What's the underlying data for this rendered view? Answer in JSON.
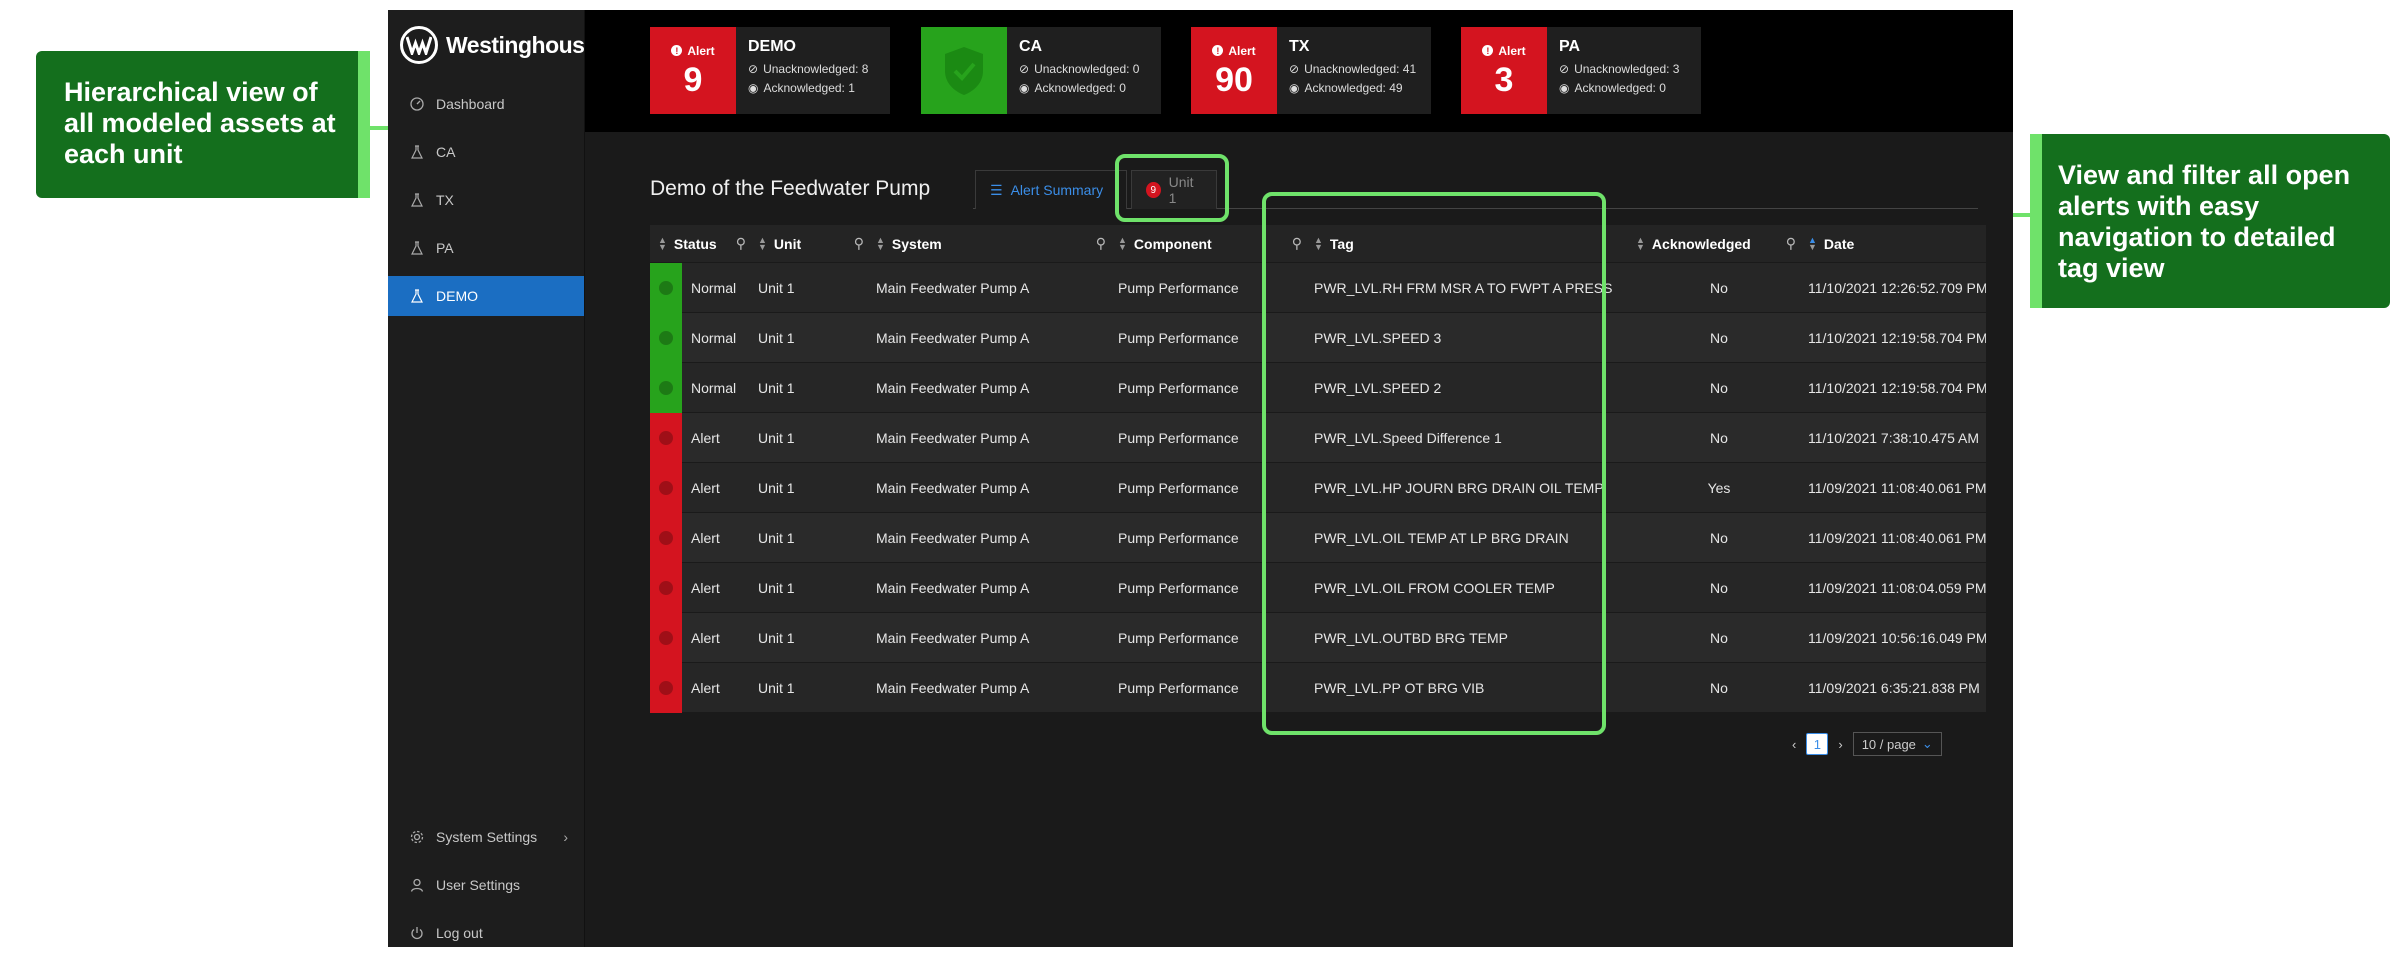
{
  "brand": {
    "name": "Westinghouse"
  },
  "sidebar": {
    "items": [
      {
        "label": "Dashboard",
        "icon": "dashboard-icon"
      },
      {
        "label": "CA",
        "icon": "flask-icon"
      },
      {
        "label": "TX",
        "icon": "flask-icon"
      },
      {
        "label": "PA",
        "icon": "flask-icon"
      },
      {
        "label": "DEMO",
        "icon": "flask-icon",
        "active": true
      }
    ],
    "bottom": [
      {
        "label": "System Settings",
        "icon": "gear-icon"
      },
      {
        "label": "User Settings",
        "icon": "user-icon"
      },
      {
        "label": "Log out",
        "icon": "power-icon"
      }
    ]
  },
  "cards": [
    {
      "name": "DEMO",
      "alert_label": "Alert",
      "count": "9",
      "unack": "Unacknowledged: 8",
      "ack": "Acknowledged: 1",
      "state": "alert"
    },
    {
      "name": "CA",
      "alert_label": "",
      "count": "",
      "unack": "Unacknowledged: 0",
      "ack": "Acknowledged: 0",
      "state": "ok"
    },
    {
      "name": "TX",
      "alert_label": "Alert",
      "count": "90",
      "unack": "Unacknowledged: 41",
      "ack": "Acknowledged: 49",
      "state": "alert"
    },
    {
      "name": "PA",
      "alert_label": "Alert",
      "count": "3",
      "unack": "Unacknowledged: 3",
      "ack": "Acknowledged: 0",
      "state": "alert"
    }
  ],
  "page": {
    "title": "Demo of the Feedwater Pump",
    "tabs": [
      {
        "label": "Alert Summary",
        "active": true
      },
      {
        "label": "Unit 1",
        "badge": "9"
      }
    ]
  },
  "table": {
    "columns": [
      "Status",
      "Unit",
      "System",
      "Component",
      "Tag",
      "Acknowledged",
      "Date"
    ],
    "rows": [
      {
        "status": "Normal",
        "unit": "Unit 1",
        "system": "Main Feedwater Pump A",
        "component": "Pump Performance",
        "tag": "PWR_LVL.RH  FRM MSR A TO FWPT A PRESS",
        "ack": "No",
        "date": "11/10/2021 12:26:52.709 PM"
      },
      {
        "status": "Normal",
        "unit": "Unit 1",
        "system": "Main Feedwater Pump A",
        "component": "Pump Performance",
        "tag": "PWR_LVL.SPEED 3",
        "ack": "No",
        "date": "11/10/2021 12:19:58.704 PM"
      },
      {
        "status": "Normal",
        "unit": "Unit 1",
        "system": "Main Feedwater Pump A",
        "component": "Pump Performance",
        "tag": "PWR_LVL.SPEED 2",
        "ack": "No",
        "date": "11/10/2021 12:19:58.704 PM"
      },
      {
        "status": "Alert",
        "unit": "Unit 1",
        "system": "Main Feedwater Pump A",
        "component": "Pump Performance",
        "tag": "PWR_LVL.Speed Difference 1",
        "ack": "No",
        "date": "11/10/2021 7:38:10.475 AM"
      },
      {
        "status": "Alert",
        "unit": "Unit 1",
        "system": "Main Feedwater Pump A",
        "component": "Pump Performance",
        "tag": "PWR_LVL.HP JOURN BRG DRAIN OIL TEMP",
        "ack": "Yes",
        "date": "11/09/2021 11:08:40.061 PM"
      },
      {
        "status": "Alert",
        "unit": "Unit 1",
        "system": "Main Feedwater Pump A",
        "component": "Pump Performance",
        "tag": "PWR_LVL.OIL TEMP AT LP BRG DRAIN",
        "ack": "No",
        "date": "11/09/2021 11:08:40.061 PM"
      },
      {
        "status": "Alert",
        "unit": "Unit 1",
        "system": "Main Feedwater Pump A",
        "component": "Pump Performance",
        "tag": "PWR_LVL.OIL FROM COOLER TEMP",
        "ack": "No",
        "date": "11/09/2021 11:08:04.059 PM"
      },
      {
        "status": "Alert",
        "unit": "Unit 1",
        "system": "Main Feedwater Pump A",
        "component": "Pump Performance",
        "tag": "PWR_LVL.OUTBD BRG TEMP",
        "ack": "No",
        "date": "11/09/2021 10:56:16.049 PM"
      },
      {
        "status": "Alert",
        "unit": "Unit 1",
        "system": "Main Feedwater Pump A",
        "component": "Pump Performance",
        "tag": "PWR_LVL.PP OT BRG VIB",
        "ack": "No",
        "date": "11/09/2021 6:35:21.838 PM"
      }
    ]
  },
  "pagination": {
    "current": "1",
    "page_size": "10 / page"
  },
  "annotations": {
    "left": "Hierarchical view of all modeled assets at each unit",
    "right": "View and filter all open alerts with easy navigation to detailed tag view"
  },
  "colors": {
    "accent": "#1b6ec2",
    "alert": "#d4141f",
    "ok": "#27a31c",
    "annotation": "#146f1d",
    "highlight": "#6fe26a"
  }
}
